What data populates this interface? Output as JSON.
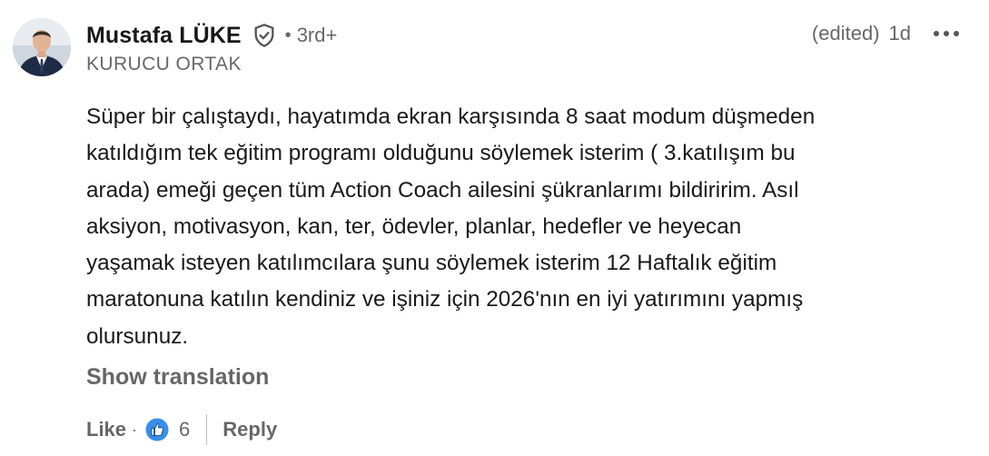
{
  "comment": {
    "author": {
      "name": "Mustafa LÜKE",
      "degree": "3rd+",
      "headline": "KURUCU ORTAK",
      "verified": true
    },
    "edited_label": "(edited)",
    "time": "1d",
    "separator": "•",
    "text_lines": [
      "Süper bir çalıştaydı, hayatımda ekran karşısında 8 saat modum düşmeden",
      "katıldığım tek eğitim programı olduğunu söylemek isterim ( 3.katılışım bu",
      "arada) emeği geçen tüm Action Coach ailesini şükranlarımı bildiririm. Asıl",
      "aksiyon, motivasyon, kan, ter, ödevler, planlar, hedefler ve heyecan",
      "yaşamak isteyen katılımcılara şunu söylemek isterim 12 Haftalık eğitim",
      "maratonuna katılın kendiniz ve işiniz için 2026'nın en iyi yatırımını yapmış",
      "olursunuz."
    ],
    "show_translation_label": "Show translation",
    "actions": {
      "like_label": "Like",
      "dot": "·",
      "reaction_count": "6",
      "reply_label": "Reply"
    }
  },
  "icons": {
    "verified": "shield-check-icon",
    "more": "more-horizontal-icon",
    "reaction": "like-reaction-icon"
  },
  "colors": {
    "text_primary": "#1a1a1a",
    "text_secondary": "#666666",
    "like_blue": "#378fe9",
    "like_blue_dark": "#0a66c2"
  }
}
